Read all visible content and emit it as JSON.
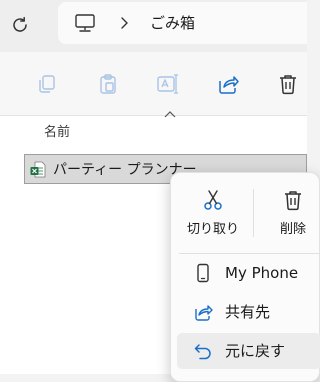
{
  "address_bar": {
    "refresh_icon": "refresh-icon",
    "location_icon": "this-pc-icon",
    "separator_icon": "chevron-right-icon",
    "current_folder": "ごみ箱"
  },
  "toolbar": {
    "buttons": [
      {
        "icon": "copy-icon",
        "enabled": false
      },
      {
        "icon": "paste-icon",
        "enabled": false
      },
      {
        "icon": "rename-icon",
        "enabled": false
      },
      {
        "icon": "share-icon",
        "enabled": true
      },
      {
        "icon": "delete-icon",
        "enabled": true
      }
    ]
  },
  "file_list": {
    "column_header": "名前",
    "sort": "ascending",
    "items": [
      {
        "name": "パーティー プランナー",
        "icon": "excel-file-icon",
        "selected": true
      }
    ]
  },
  "context_menu": {
    "quick_actions": [
      {
        "label": "切り取り",
        "icon": "scissors-icon"
      },
      {
        "label": "削除",
        "icon": "trash-icon"
      }
    ],
    "items": [
      {
        "label": "My Phone",
        "icon": "phone-icon",
        "hovered": false
      },
      {
        "label": "共有先",
        "icon": "share-icon",
        "hovered": false
      },
      {
        "label": "元に戻す",
        "icon": "undo-icon",
        "hovered": true
      }
    ]
  },
  "colors": {
    "accent": "#1a6fc9",
    "excel_green": "#1e7145",
    "disabled_icon": "#a9c4e4"
  }
}
